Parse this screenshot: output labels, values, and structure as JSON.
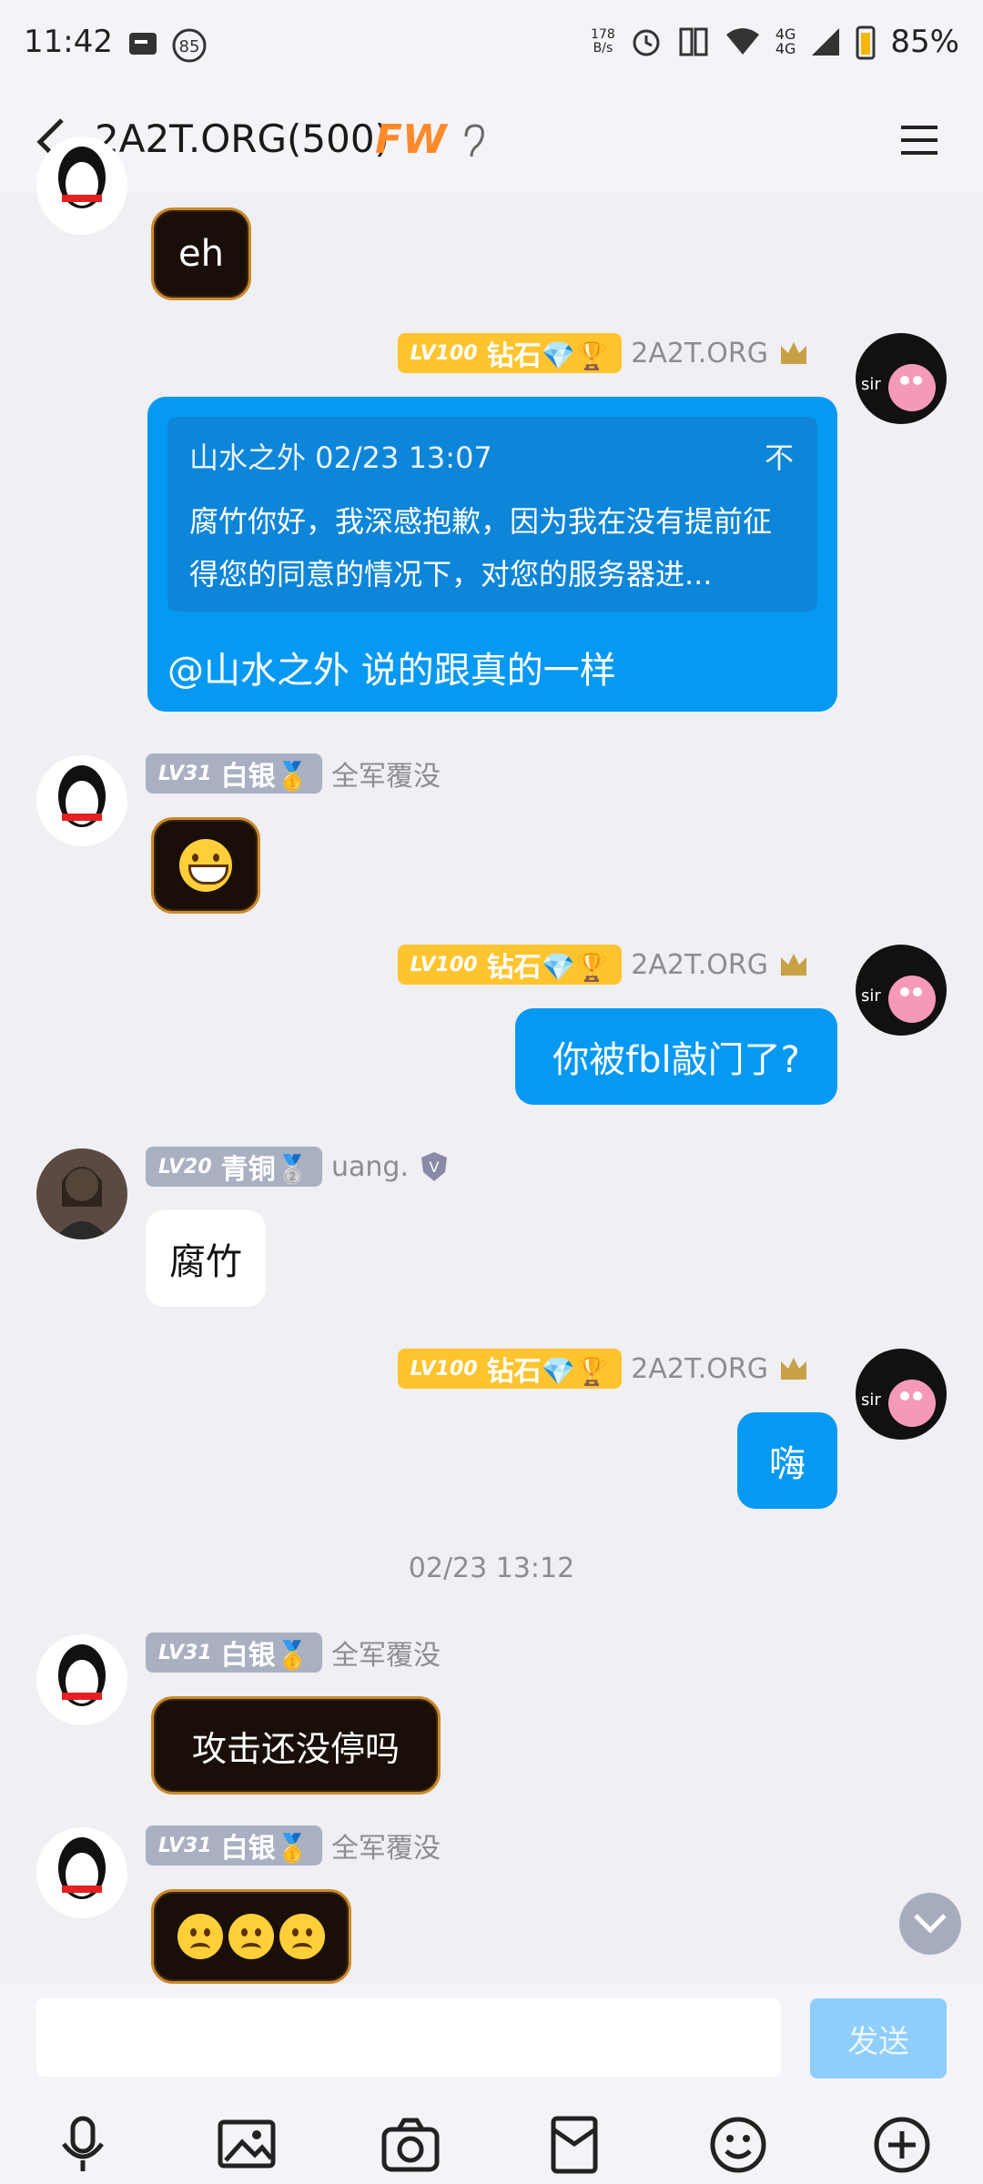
{
  "status_bar": {
    "time": "11:42",
    "net_speed": "178\nB/s",
    "signal": "4G",
    "battery": "85%",
    "notification_count": "85"
  },
  "header": {
    "title": "2A2T.ORG(500)",
    "badge": "FW"
  },
  "messages": [
    {
      "side": "left",
      "avatar": "qq-penguin",
      "text": "eh",
      "style": "dark"
    },
    {
      "side": "right",
      "level": "LV100",
      "rank": "钻石💎🏆",
      "nick": "2A2T.ORG",
      "quote": {
        "author_time": "山水之外 02/23 13:07",
        "collapse": "不",
        "text": "腐竹你好，我深感抱歉，因为我在没有提前征得您的同意的情况下，对您的服务器进..."
      },
      "text": "@山水之外 说的跟真的一样"
    },
    {
      "side": "left",
      "level": "LV31",
      "rank": "白银🥇",
      "nick": "全军覆没",
      "emoji": "grin",
      "style": "dark"
    },
    {
      "side": "right",
      "level": "LV100",
      "rank": "钻石💎🏆",
      "nick": "2A2T.ORG",
      "text": "你被fbl敲门了?"
    },
    {
      "side": "left",
      "level": "LV20",
      "rank": "青铜🥈",
      "nick": "uang.",
      "text": "腐竹",
      "style": "white"
    },
    {
      "side": "right",
      "level": "LV100",
      "rank": "钻石💎🏆",
      "nick": "2A2T.ORG",
      "text": "嗨"
    },
    {
      "timestamp": "02/23 13:12"
    },
    {
      "side": "left",
      "level": "LV31",
      "rank": "白银🥇",
      "nick": "全军覆没",
      "text": "攻击还没停吗",
      "style": "dark"
    },
    {
      "side": "left",
      "level": "LV31",
      "rank": "白银🥇",
      "nick": "全军覆没",
      "emoji": "sad x3",
      "style": "dark"
    }
  ],
  "input": {
    "placeholder": "",
    "send_label": "发送"
  },
  "toolbar": [
    "microphone-icon",
    "image-icon",
    "camera-icon",
    "red-packet-icon",
    "emoji-icon",
    "plus-icon"
  ]
}
